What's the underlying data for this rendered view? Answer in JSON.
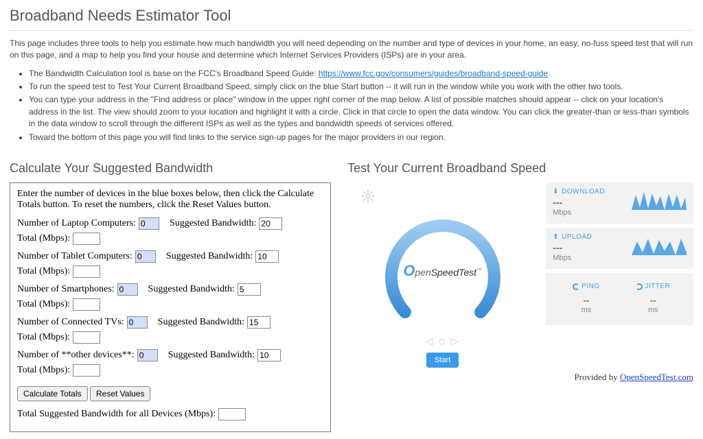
{
  "pageTitle": "Broadband Needs Estimator Tool",
  "intro": "This page includes three tools to help you estimate how much bandwidth you will need depending on the number and type of devices in your home, an easy, no-fuss speed test that will run on this page, and a map to help you find your house and determine which Internet Services Providers (ISPs) are in your area.",
  "bullets": {
    "b1a": "The Bandwidth Calculation tool is base on the FCC's Broadband Speed Guide:  ",
    "b1link": "https://www.fcc.gov/consumers/guides/broadband-speed-guide",
    "b1b": ".",
    "b2": "To run the speed test to Test Your Current Broadband Speed, simply click on the blue Start button -- it will run in the window while you work with the other two tools.",
    "b3": "You can type your address in the \"Find address or place\" window in the upper right corner of the map below.  A list of possible matches should appear -- click on your location's address in the list.  The view should zoom to your location and highlight it with a circle.  Click in that circle to open the data window.  You can click the greater-than or less-than symbols in the data window to scroll through the different ISPs as well as the types and bandwidth speeds of services offered.",
    "b4": "Toward the bottom of this page you will find links to the service sign-up pages for the major providers in our region."
  },
  "calc": {
    "heading": "Calculate Your Suggested Bandwidth",
    "prompt": "Enter the number of devices in the blue boxes below, then click the Calculate Totals button. To reset the numbers, click the Reset Values button.",
    "rows": [
      {
        "label": "Number of Laptop Computers:",
        "count": "0",
        "sglabel": "Suggested Bandwidth:",
        "sg": "20",
        "totlabel": "Total (Mbps):"
      },
      {
        "label": "Number of Tablet Computers:",
        "count": "0",
        "sglabel": "Suggested Bandwidth:",
        "sg": "10",
        "totlabel": "Total (Mbps):"
      },
      {
        "label": "Number of Smartphones:",
        "count": "0",
        "sglabel": "Suggested Bandwidth:",
        "sg": "5",
        "totlabel": "Total (Mbps):"
      },
      {
        "label": "Number of Connected TVs:",
        "count": "0",
        "sglabel": "Suggested Bandwidth:",
        "sg": "15",
        "totlabel": "Total (Mbps):"
      },
      {
        "label": "Number of **other devices**:",
        "count": "0",
        "sglabel": "Suggested Bandwidth:",
        "sg": "10",
        "totlabel": "Total (Mbps):"
      }
    ],
    "btnCalc": "Calculate Totals",
    "btnReset": "Reset Values",
    "finalLabel": "Total Suggested Bandwidth for all Devices (Mbps):"
  },
  "speed": {
    "heading": "Test Your Current Broadband Speed",
    "brand": "OpenSpeedTest",
    "startLabel": "Start",
    "download": {
      "label": "DOWNLOAD",
      "value": "---",
      "unit": "Mbps"
    },
    "upload": {
      "label": "UPLOAD",
      "value": "---",
      "unit": "Mbps"
    },
    "ping": {
      "label": "PING",
      "value": "--",
      "unit": "ms"
    },
    "jitter": {
      "label": "JITTER",
      "value": "--",
      "unit": "ms"
    },
    "providedPrefix": "Provided by ",
    "providedLink": "OpenSpeedTest.com"
  }
}
